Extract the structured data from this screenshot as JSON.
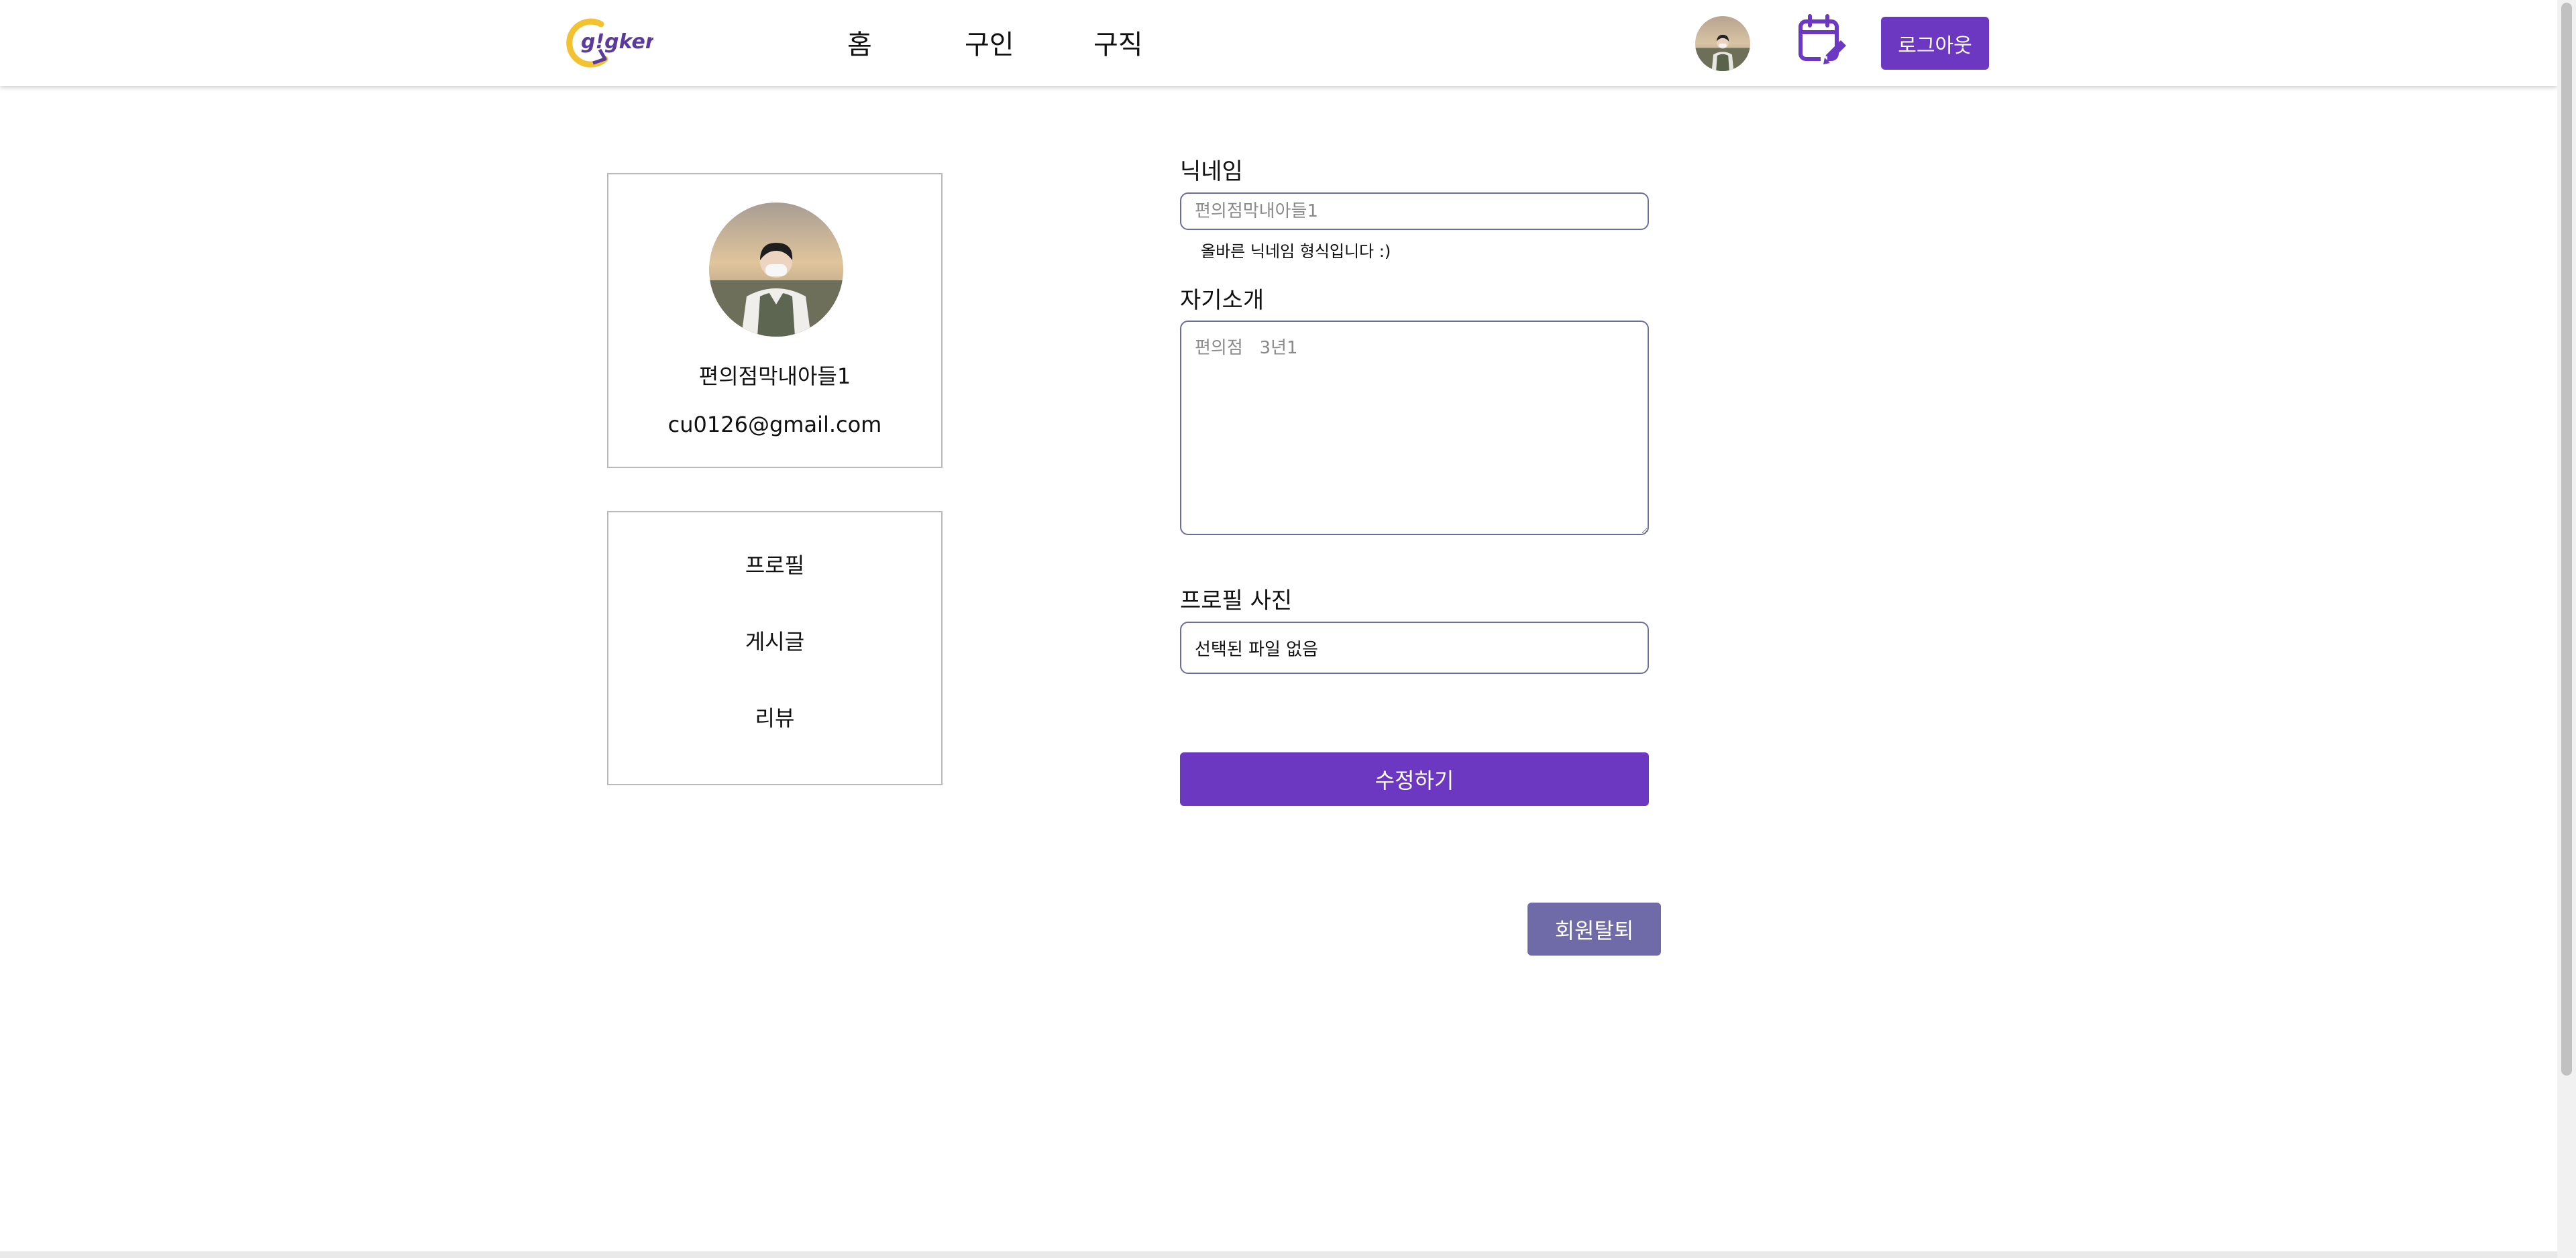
{
  "header": {
    "logo_text": "g!gker",
    "nav": [
      "홈",
      "구인",
      "구직"
    ],
    "logout_label": "로그아웃"
  },
  "profile": {
    "name": "편의점막내아들1",
    "email": "cu0126@gmail.com"
  },
  "menu": {
    "items": [
      "프로필",
      "게시글",
      "리뷰"
    ]
  },
  "form": {
    "nickname_label": "닉네임",
    "nickname_placeholder": "편의점막내아들1",
    "nickname_help": "올바른 닉네임 형식입니다 :)",
    "intro_label": "자기소개",
    "intro_placeholder": "편의점   3년1",
    "photo_label": "프로필 사진",
    "file_status": "선택된 파일 없음",
    "submit_label": "수정하기",
    "withdraw_label": "회원탈퇴"
  },
  "colors": {
    "primary": "#6c38c2",
    "withdraw": "#6f6aa8",
    "input_border": "#6b6e9c",
    "logo_yellow": "#f2c230",
    "logo_purple": "#5b3a9e"
  },
  "icons": [
    "gigker-logo",
    "user-avatar",
    "calendar-edit-icon"
  ]
}
